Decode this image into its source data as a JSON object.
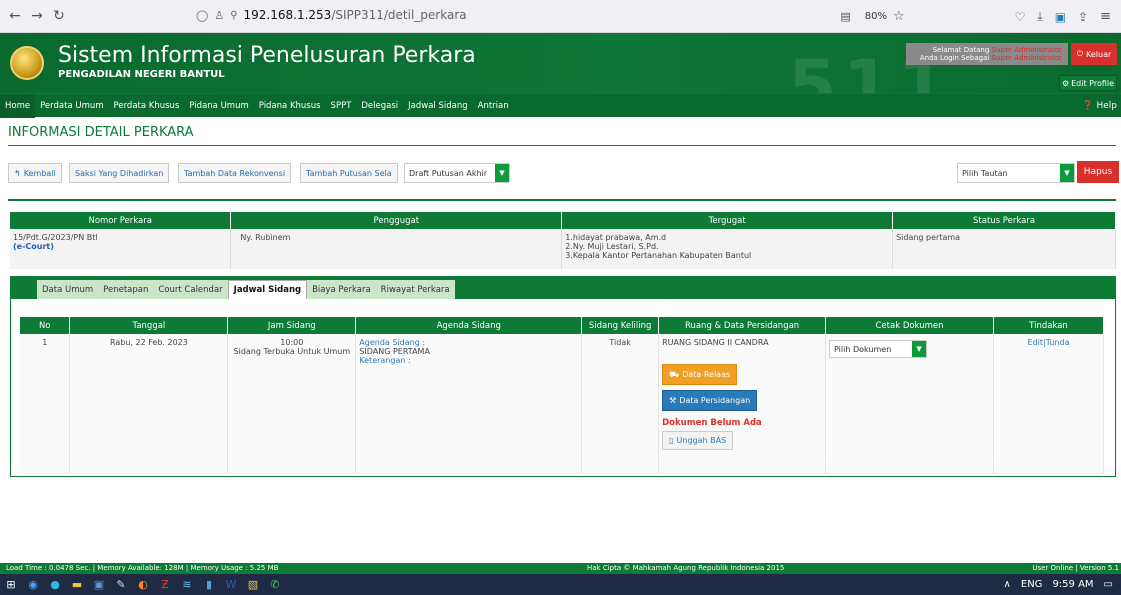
{
  "browser": {
    "url_host": "192.168.1.253",
    "url_path": "/SIPP311/detil_perkara",
    "zoom": "80%"
  },
  "header": {
    "title": "Sistem Informasi Penelusuran Perkara",
    "subtitle": "PENGADILAN NEGERI BANTUL",
    "watermark": "511",
    "welcome_line1": "Selamat Datang",
    "welcome_line2": "Anda Login Sebagai",
    "role_line1": "Super Administrator",
    "role_line2": "Super Administrator",
    "logout_label": "Keluar",
    "edit_profile_label": "Edit Profile"
  },
  "menu": {
    "items": [
      "Home",
      "Perdata Umum",
      "Perdata Khusus",
      "Pidana Umum",
      "Pidana Khusus",
      "SPPT",
      "Delegasi",
      "Jadwal Sidang",
      "Antrian"
    ],
    "help_label": "Help"
  },
  "page": {
    "title": "INFORMASI DETAIL PERKARA",
    "buttons": {
      "kembali": "Kembali",
      "saksi": "Saksi Yang Dihadirkan",
      "rekonvensi": "Tambah Data Rekonvensi",
      "putusan_sela": "Tambah Putusan Sela"
    },
    "draft_select": "Draft Putusan Akhir",
    "tautan_select": "Pilih Tautan",
    "hapus_label": "Hapus"
  },
  "case": {
    "headers": [
      "Nomor Perkara",
      "Penggugat",
      "Tergugat",
      "Status Perkara"
    ],
    "nomor": "15/Pdt.G/2023/PN Btl",
    "ecourt": "(e-Court)",
    "penggugat": "Ny. Rubinem",
    "tergugat": [
      "1.hidayat prabawa, Am.d",
      "2.Ny. Muji Lestari, S.Pd.",
      "3.Kepala Kantor Pertanahan Kabupaten Bantul"
    ],
    "status": "Sidang pertama"
  },
  "tabs": [
    "Data Umum",
    "Penetapan",
    "Court Calendar",
    "Jadwal Sidang",
    "Biaya Perkara",
    "Riwayat Perkara"
  ],
  "schedule": {
    "headers": [
      "No",
      "Tanggal",
      "Jam Sidang",
      "Agenda Sidang",
      "Sidang Keliling",
      "Ruang & Data Persidangan",
      "Cetak Dokumen",
      "Tindakan"
    ],
    "row": {
      "no": "1",
      "tanggal": "Rabu, 22 Feb. 2023",
      "jam": "10:00",
      "jam_note": "Sidang Terbuka Untuk Umum",
      "agenda_label": "Agenda Sidang :",
      "agenda_value": "SIDANG PERTAMA",
      "keterangan_label": "Keterangan :",
      "keliling": "Tidak",
      "ruang": "RUANG SIDANG II CANDRA",
      "relaas_label": "Data Relaas",
      "persidangan_label": "Data Persidangan",
      "doc_missing": "Dokumen Belum Ada",
      "unggah_label": "Unggah BAS",
      "cetak_select": "Pilih Dokumen",
      "edit_label": "Edit",
      "sep": "|",
      "tunda_label": "Tunda"
    }
  },
  "status_bar": {
    "left": "Load Time : 0.0478 Sec. | Memory Available: 128M | Memory Usage : 5.25 MB",
    "mid": "Hak Cipta © Mahkamah Agung Republik Indonesia 2015",
    "right": "User Online | Version 5.1"
  },
  "taskbar": {
    "lang": "ENG",
    "time": "9:59 AM"
  },
  "colors": {
    "brand_green": "#0d7a35",
    "danger_red": "#d9302c",
    "link_blue": "#2a7ab8",
    "warning_orange": "#f0a022"
  }
}
